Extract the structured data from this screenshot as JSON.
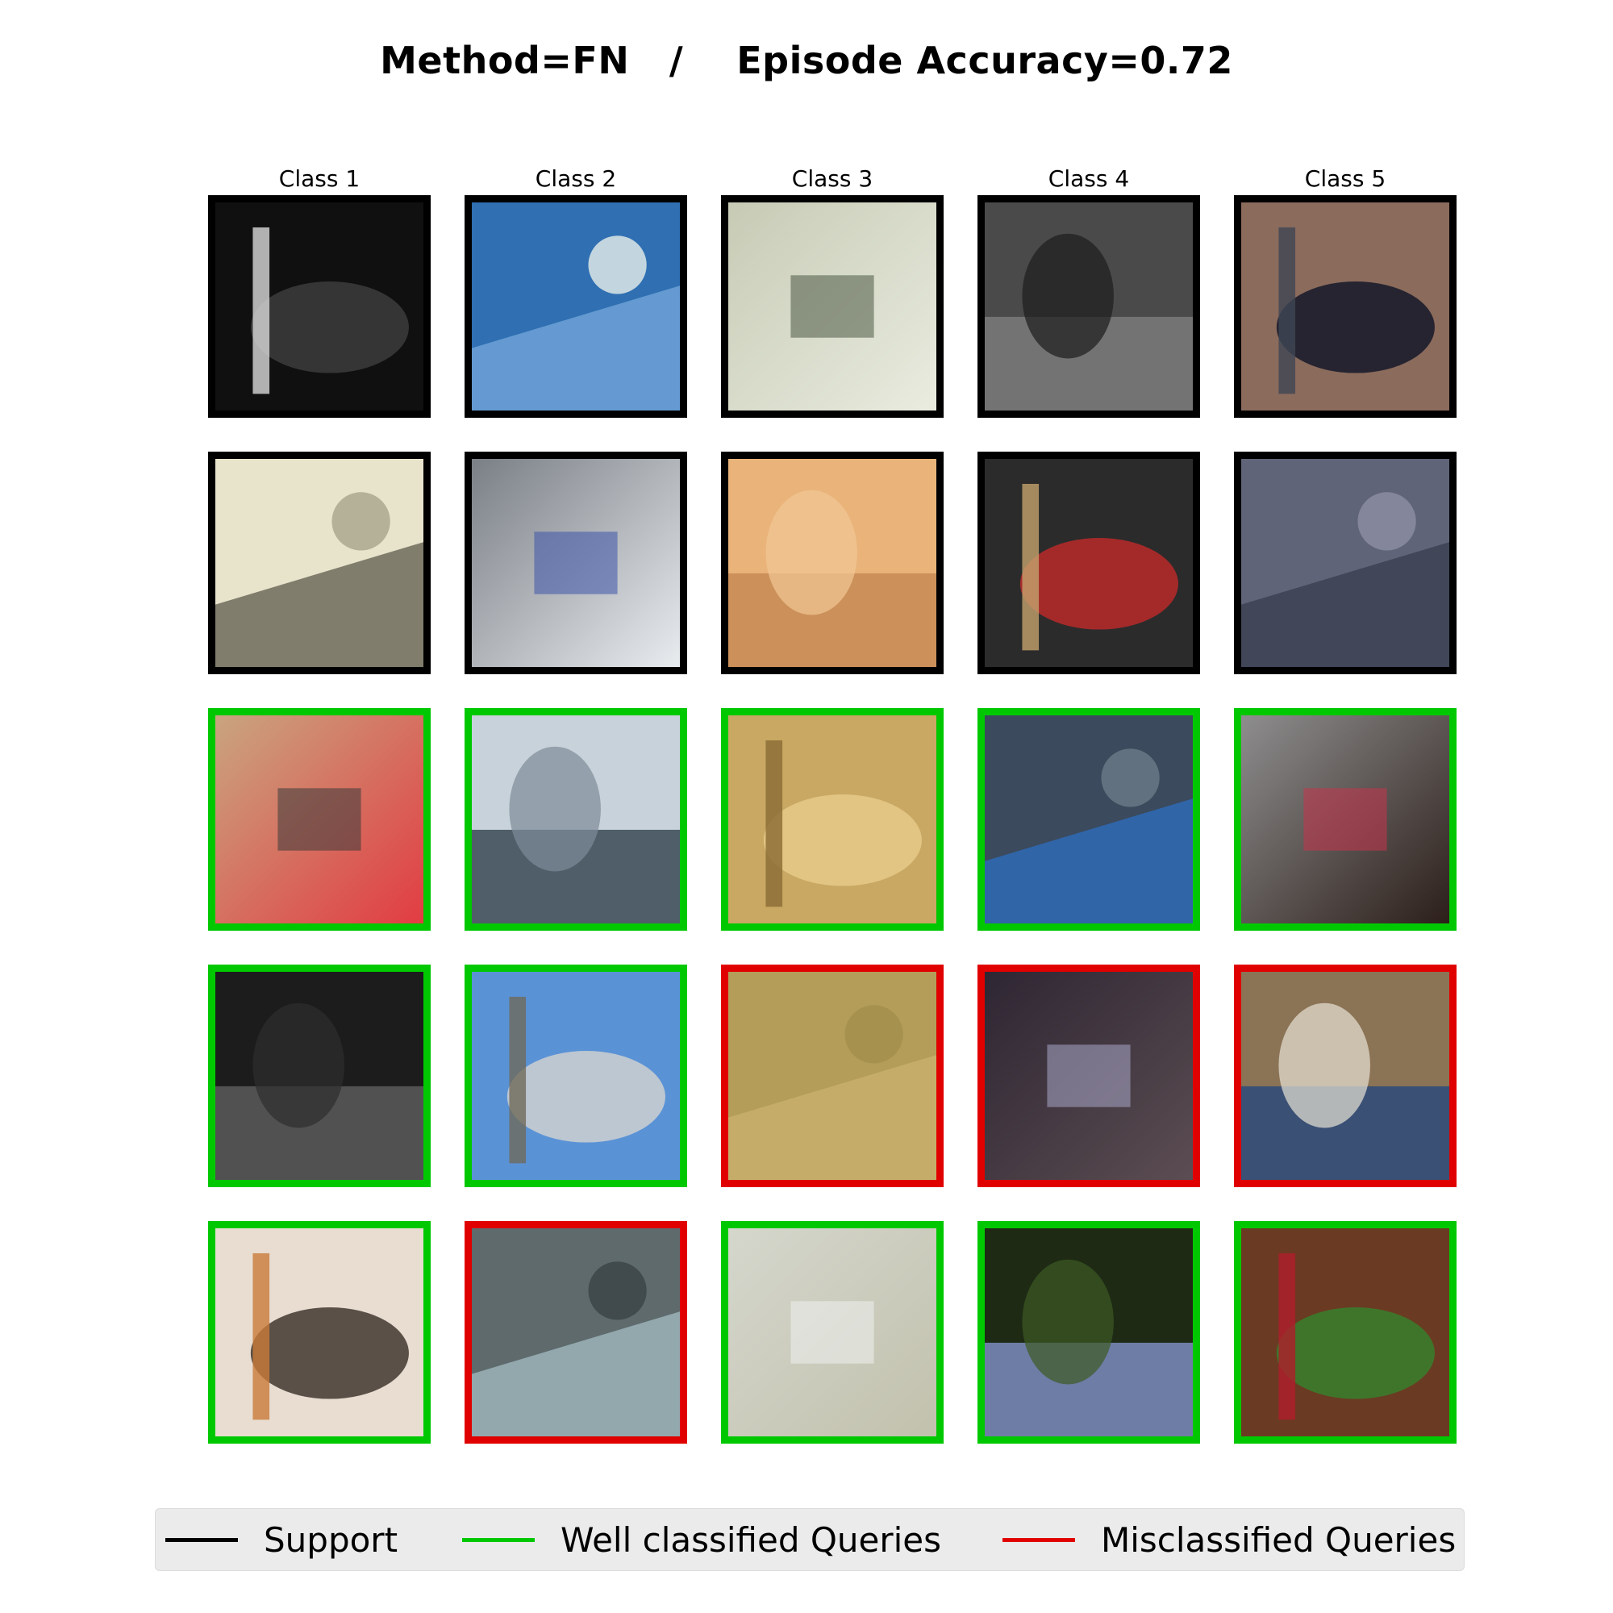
{
  "title": "Method=FN   /    Episode Accuracy=0.72",
  "columns": [
    "Class 1",
    "Class 2",
    "Class 3",
    "Class 4",
    "Class 5"
  ],
  "colors": {
    "support": "#000000",
    "well_classified": "#00c800",
    "misclassified": "#e00000"
  },
  "grid": [
    [
      {
        "role": "support",
        "subject": "bird-on-pole",
        "palette": [
          "#101010",
          "#3a3a3a",
          "#d9d9d9"
        ]
      },
      {
        "role": "support",
        "subject": "airplane",
        "palette": [
          "#2f6fb2",
          "#6da2d6",
          "#e8efe9"
        ]
      },
      {
        "role": "support",
        "subject": "sink",
        "palette": [
          "#c7cbb5",
          "#e9ecdf",
          "#4d5a45"
        ]
      },
      {
        "role": "support",
        "subject": "chain-fence",
        "palette": [
          "#4a4a4a",
          "#7a7a7a",
          "#1c1c1c"
        ]
      },
      {
        "role": "support",
        "subject": "horse",
        "palette": [
          "#8b6b5c",
          "#1b1d2c",
          "#3e4655"
        ]
      }
    ],
    [
      {
        "role": "support",
        "subject": "blurry-close-up",
        "palette": [
          "#e8e4cc",
          "#6d6b5a",
          "#a7a48c"
        ]
      },
      {
        "role": "support",
        "subject": "airplanes",
        "palette": [
          "#7a7f86",
          "#e9ecef",
          "#3d54a8"
        ]
      },
      {
        "role": "support",
        "subject": "wood-surface",
        "palette": [
          "#e9b37a",
          "#c78a55",
          "#f1c894"
        ]
      },
      {
        "role": "support",
        "subject": "people-on-bench",
        "palette": [
          "#2b2b2b",
          "#b12a2a",
          "#c4a36e"
        ]
      },
      {
        "role": "support",
        "subject": "blurry-dark",
        "palette": [
          "#5f6478",
          "#3c4154",
          "#8d8fa4"
        ]
      }
    ],
    [
      {
        "role": "well_classified",
        "subject": "bicycle",
        "palette": [
          "#c9a57f",
          "#e23c42",
          "#3a3a3a"
        ]
      },
      {
        "role": "well_classified",
        "subject": "airplane-close-up",
        "palette": [
          "#c8d2da",
          "#3a4a55",
          "#7d8c99"
        ]
      },
      {
        "role": "well_classified",
        "subject": "sink",
        "palette": [
          "#c9a863",
          "#e4c886",
          "#8a6a33"
        ]
      },
      {
        "role": "well_classified",
        "subject": "person-blurry",
        "palette": [
          "#3b4a5c",
          "#2f6ab5",
          "#6b7a88"
        ]
      },
      {
        "role": "well_classified",
        "subject": "horse",
        "palette": [
          "#8e8e8e",
          "#2c1f1a",
          "#c7354c"
        ]
      }
    ],
    [
      {
        "role": "well_classified",
        "subject": "dark-blur",
        "palette": [
          "#1c1c1c",
          "#5a5a5a",
          "#2e2e2e"
        ]
      },
      {
        "role": "well_classified",
        "subject": "jet-tail",
        "palette": [
          "#5a92d6",
          "#c7cdd0",
          "#6f6a5a"
        ]
      },
      {
        "role": "misclassified",
        "subject": "flat-surface",
        "palette": [
          "#b39d58",
          "#c8b06c",
          "#a48e4d"
        ]
      },
      {
        "role": "misclassified",
        "subject": "dark-blur",
        "palette": [
          "#2e2633",
          "#5b4d52",
          "#a9a8c8"
        ]
      },
      {
        "role": "misclassified",
        "subject": "rider-on-horse",
        "palette": [
          "#8b7355",
          "#2c4a7a",
          "#e8e2d6"
        ]
      }
    ],
    [
      {
        "role": "well_classified",
        "subject": "bicycle-blur",
        "palette": [
          "#e8ddd0",
          "#4a4038",
          "#c97a3a"
        ]
      },
      {
        "role": "misclassified",
        "subject": "blurry-plane",
        "palette": [
          "#5e6a6c",
          "#9bb3b8",
          "#3a4446"
        ]
      },
      {
        "role": "well_classified",
        "subject": "blurry-light",
        "palette": [
          "#d5d7cd",
          "#c2c1ad",
          "#eef0ef"
        ]
      },
      {
        "role": "well_classified",
        "subject": "pole",
        "palette": [
          "#1e2a14",
          "#7c8cc0",
          "#3c5a23"
        ]
      },
      {
        "role": "well_classified",
        "subject": "horse",
        "palette": [
          "#6a3b22",
          "#3b7c2c",
          "#b01e2c"
        ]
      }
    ]
  ],
  "legend": [
    {
      "key": "support",
      "label": "Support"
    },
    {
      "key": "well_classified",
      "label": "Well classified Queries"
    },
    {
      "key": "misclassified",
      "label": "Misclassified Queries"
    }
  ]
}
